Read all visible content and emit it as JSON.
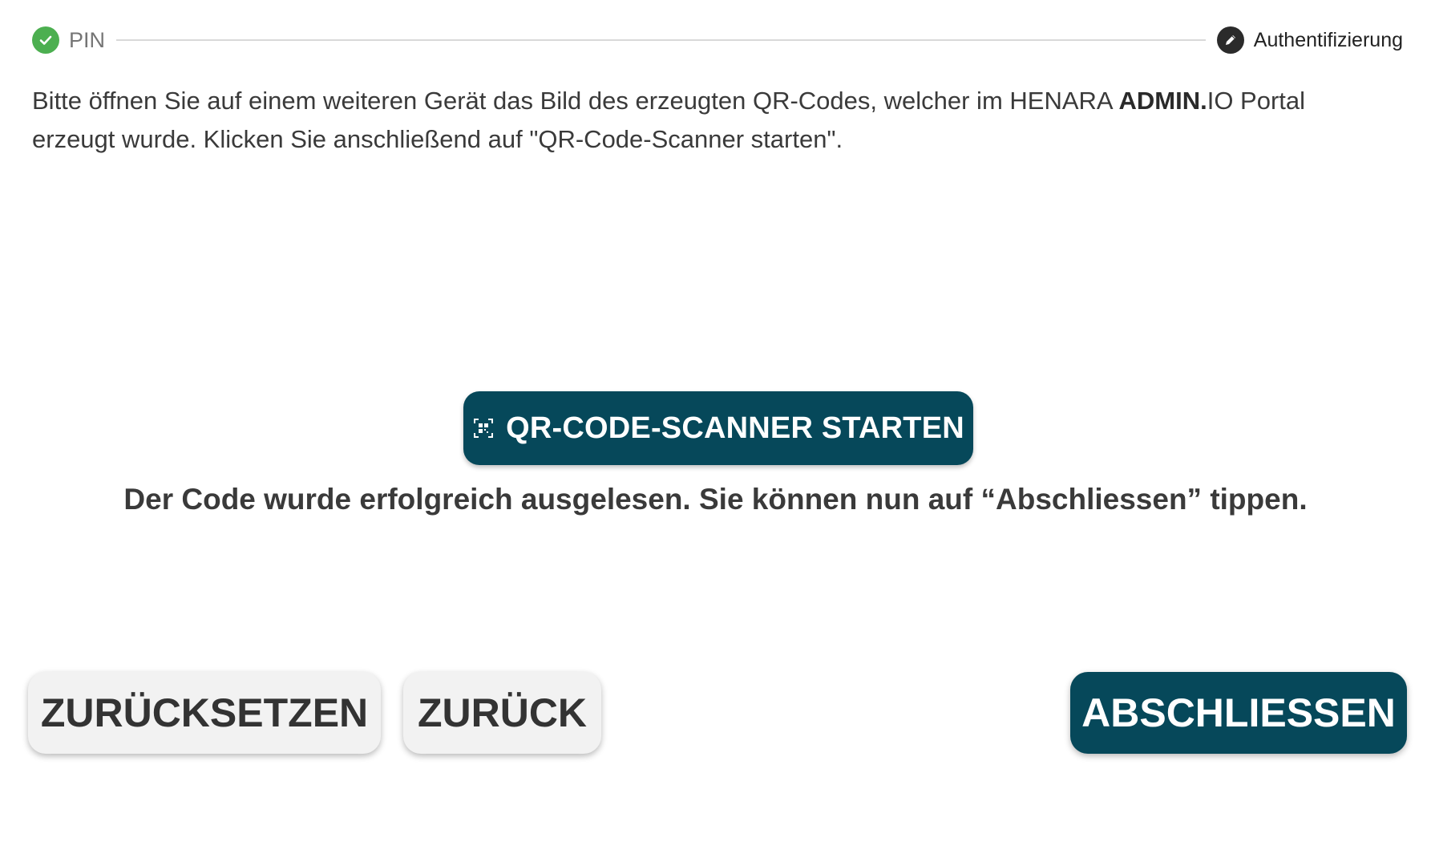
{
  "stepper": {
    "steps": [
      {
        "label": "PIN",
        "state": "done",
        "icon": "check-circle-icon"
      },
      {
        "label": "Authentifizierung",
        "state": "active",
        "icon": "pencil-icon"
      }
    ]
  },
  "instruction": {
    "part1": "Bitte öffnen Sie auf einem weiteren Gerät das Bild des erzeugten QR-Codes, welcher im HENARA ",
    "brand": "ADMIN.",
    "part2": "IO Portal erzeugt wurde. Klicken Sie anschließend auf \"QR-Code-Scanner starten\"."
  },
  "scanner": {
    "label": "QR-CODE-SCANNER STARTEN",
    "icon": "qr-code-scan-icon"
  },
  "status": {
    "message": "Der Code wurde erfolgreich ausgelesen. Sie können nun auf “Abschliessen” tippen."
  },
  "actions": {
    "reset_label": "ZURÜCKSETZEN",
    "back_label": "ZURÜCK",
    "finish_label": "ABSCHLIESSEN"
  },
  "colors": {
    "primary": "#06485a",
    "success": "#4caf50",
    "secondary_bg": "#f2f2f2"
  }
}
